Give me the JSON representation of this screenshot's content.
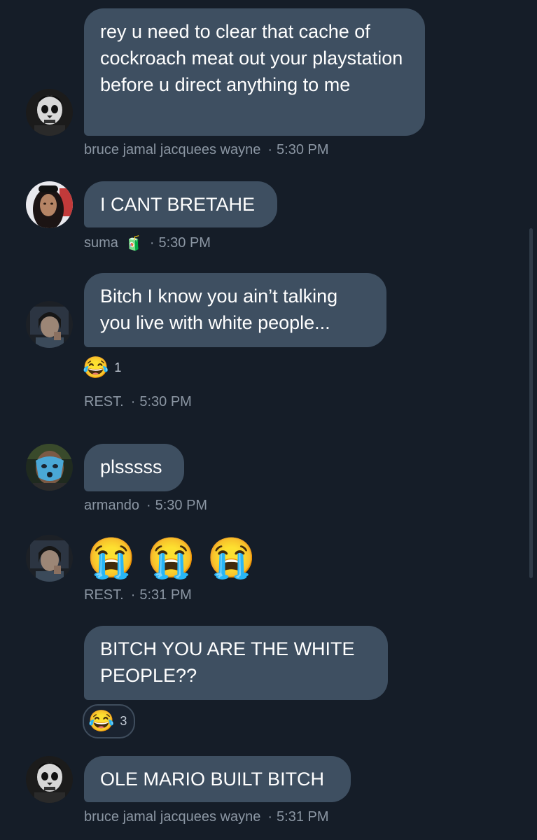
{
  "messages": [
    {
      "id": "m1",
      "text": "rey u need to clear that cache of cockroach meat out your playstation before u direct anything to me",
      "sender": "bruce jamal jacquees wayne",
      "time": "5:30 PM",
      "avatar": "skull-avatar"
    },
    {
      "id": "m2",
      "text": "I CANT BRETAHE",
      "sender": "suma",
      "sender_badge": "🧃",
      "time": "5:30 PM",
      "avatar": "girl-avatar"
    },
    {
      "id": "m3",
      "text": "Bitch I know you ain’t talking you live with white people...",
      "sender": "REST.",
      "time": "5:30 PM",
      "reaction": {
        "emoji": "😂",
        "count": "1"
      },
      "avatar": "rest-avatar"
    },
    {
      "id": "m4",
      "text": "plsssss",
      "sender": "armando",
      "time": "5:30 PM",
      "avatar": "mask-avatar"
    },
    {
      "id": "m5",
      "emojis": [
        "😭",
        "😭",
        "😭"
      ],
      "sender": "REST.",
      "time": "5:31 PM",
      "avatar": "rest-avatar"
    },
    {
      "id": "m6",
      "text": "BITCH YOU ARE THE WHITE PEOPLE??",
      "reaction": {
        "emoji": "😂",
        "count": "3"
      }
    },
    {
      "id": "m7",
      "text": "OLE MARIO BUILT BITCH",
      "sender": "bruce jamal jacquees wayne",
      "time": "5:31 PM",
      "avatar": "skull-avatar"
    }
  ],
  "separator": "·",
  "colors": {
    "background": "#151d28",
    "bubble": "#3e4f61",
    "meta_text": "#8b96a3"
  }
}
